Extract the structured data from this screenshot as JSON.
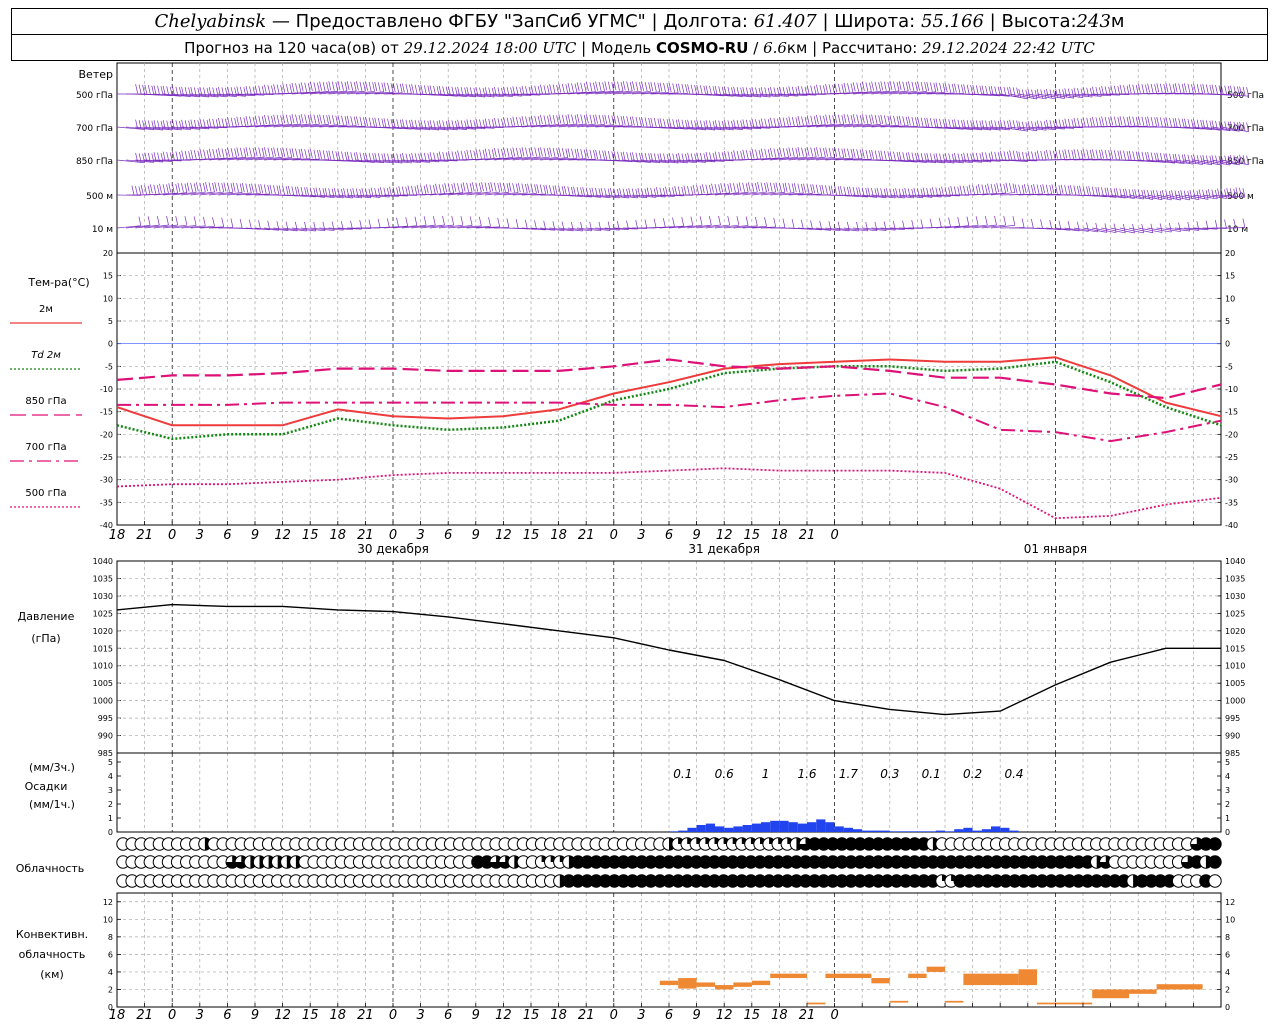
{
  "header": {
    "city": "Chelyabinsk",
    "dash": "—",
    "provider": "Предоставлено ФГБУ \"ЗапСиб УГМС\"",
    "lon_label": "Долгота:",
    "lon": "61.407",
    "lat_label": "Широта:",
    "lat": "55.166",
    "alt_label": "Высота:",
    "alt": "243",
    "alt_unit": "м",
    "sep": "|",
    "forecast_label": "Прогноз на 120 часа(ов) от",
    "forecast_start": "29.12.2024 18:00 UTC",
    "model_label": "Модель",
    "model": "COSMO-RU",
    "slash": "/",
    "resolution": "6.6",
    "res_unit": "км",
    "computed_label": "Рассчитано:",
    "computed": "29.12.2024 22:42 UTC"
  },
  "chart_data": [
    {
      "type": "wind-barbs",
      "title": "Ветер",
      "levels": [
        "500 гПа",
        "700 гПа",
        "850 гПа",
        "500 м",
        "10 м"
      ],
      "color": "#7b2fbf"
    },
    {
      "type": "line",
      "ylabel": "Тем-ра(°C)",
      "ylim": [
        -40,
        20
      ],
      "yticks": [
        20,
        15,
        10,
        5,
        0,
        -5,
        -10,
        -15,
        -20,
        -25,
        -30,
        -35,
        -40
      ],
      "x_hours": [
        0,
        6,
        12,
        18,
        24,
        30,
        36,
        42,
        48,
        54,
        60,
        66,
        72,
        78,
        84,
        90,
        96,
        102,
        108,
        114,
        120
      ],
      "series": [
        {
          "name": "2м",
          "color": "#ee3b3b",
          "style": "solid",
          "values": [
            -14,
            -18,
            -18,
            -18,
            -14.5,
            -16,
            -16.5,
            -16,
            -14.5,
            -11,
            -8.5,
            -5.5,
            -4.5,
            -4,
            -3.5,
            -4,
            -4,
            -3,
            -7,
            -13,
            -16
          ]
        },
        {
          "name": "Td 2м",
          "color": "#118811",
          "style": "dotted",
          "values": [
            -18,
            -21,
            -20,
            -20,
            -16.5,
            -18,
            -19,
            -18.5,
            -17,
            -12.5,
            -10,
            -6.5,
            -5.5,
            -5,
            -5,
            -6,
            -5.5,
            -4,
            -8.5,
            -14,
            -18
          ]
        },
        {
          "name": "850 гПа",
          "color": "#dd1177",
          "style": "dash",
          "values": [
            -8,
            -7,
            -7,
            -6.5,
            -5.5,
            -5.5,
            -6,
            -6,
            -6,
            -5,
            -3.5,
            -5,
            -5.5,
            -5,
            -6,
            -7.5,
            -7.5,
            -9,
            -11,
            -12,
            -9
          ]
        },
        {
          "name": "700 гПа",
          "color": "#dd1177",
          "style": "dashdot",
          "values": [
            -13.5,
            -13.5,
            -13.5,
            -13,
            -13,
            -13,
            -13,
            -13,
            -13,
            -13.5,
            -13.5,
            -14,
            -12.5,
            -11.5,
            -11,
            -14,
            -19,
            -19.5,
            -21.5,
            -19.5,
            -17
          ]
        },
        {
          "name": "500 гПа",
          "color": "#dd1177",
          "style": "finedot",
          "values": [
            -31.5,
            -31,
            -31,
            -30.5,
            -30,
            -29,
            -28.5,
            -28.5,
            -28.5,
            -28.5,
            -28,
            -27.5,
            -28,
            -28,
            -28,
            -28.5,
            -32,
            -38.5,
            -38,
            -35.5,
            -34
          ]
        }
      ],
      "day_labels": [
        "30 декабря",
        "31 декабря",
        "01 января"
      ],
      "hour_labels": [
        "18",
        "21",
        "0",
        "3",
        "6",
        "9",
        "12",
        "15",
        "18",
        "21",
        "0",
        "3",
        "6",
        "9",
        "12",
        "15",
        "18",
        "21",
        "0",
        "3",
        "6",
        "9",
        "12",
        "15",
        "18",
        "21",
        "0"
      ]
    },
    {
      "type": "line",
      "ylabel": "Давление",
      "ylabel2": "(гПа)",
      "ylim": [
        985,
        1040
      ],
      "yticks": [
        1040,
        1035,
        1030,
        1025,
        1020,
        1015,
        1010,
        1005,
        1000,
        995,
        990,
        985
      ],
      "x_hours": [
        0,
        6,
        12,
        18,
        24,
        30,
        36,
        42,
        48,
        54,
        60,
        66,
        72,
        78,
        84,
        90,
        96,
        102,
        108,
        114,
        120
      ],
      "series": [
        {
          "color": "#000000",
          "values": [
            1026,
            1027.5,
            1027,
            1027,
            1026,
            1025.5,
            1024,
            1022,
            1020,
            1018,
            1014.5,
            1011.5,
            1006,
            1000,
            997.5,
            996,
            997,
            1004.5,
            1011,
            1015,
            1015
          ]
        }
      ]
    },
    {
      "type": "bar",
      "ylabel_top": "(мм/3ч.)",
      "ylabel": "Осадки",
      "ylabel_bottom": "(мм/1ч.)",
      "ylim": [
        0,
        5
      ],
      "yticks": [
        5,
        4,
        3,
        2,
        1,
        0
      ],
      "color": "#2244ee",
      "labels": [
        {
          "hour": 61.5,
          "text": "0.1"
        },
        {
          "hour": 66,
          "text": "0.6"
        },
        {
          "hour": 70.5,
          "text": "1"
        },
        {
          "hour": 75,
          "text": "1.6"
        },
        {
          "hour": 79.5,
          "text": "1.7"
        },
        {
          "hour": 84,
          "text": "0.3"
        },
        {
          "hour": 88.5,
          "text": "0.1"
        },
        {
          "hour": 93,
          "text": "0.2"
        },
        {
          "hour": 97.5,
          "text": "0.4"
        }
      ],
      "hours": [
        60.5,
        61.5,
        62.5,
        63.5,
        64.5,
        65.5,
        66.5,
        67.5,
        68.5,
        69.5,
        70.5,
        71.5,
        72.5,
        73.5,
        74.5,
        75.5,
        76.5,
        77.5,
        78.5,
        79.5,
        80.5,
        81.5,
        82.5,
        83.5,
        84.5,
        85.5,
        86.5,
        87.5,
        88.5,
        89.5,
        90.5,
        91.5,
        92.5,
        93.5,
        94.5,
        95.5,
        96.5,
        97.5
      ],
      "values": [
        0.05,
        0.1,
        0.3,
        0.5,
        0.6,
        0.4,
        0.3,
        0.4,
        0.5,
        0.6,
        0.7,
        0.8,
        0.8,
        0.7,
        0.6,
        0.7,
        0.9,
        0.7,
        0.4,
        0.3,
        0.2,
        0.1,
        0.1,
        0.1,
        0.05,
        0.05,
        0.05,
        0.05,
        0.05,
        0.1,
        0.05,
        0.2,
        0.3,
        0.1,
        0.2,
        0.4,
        0.3,
        0.1
      ]
    },
    {
      "type": "symbols",
      "ylabel": "Облачность",
      "rows": [
        {
          "filled": [
            [
              9,
              9,
              0.5
            ],
            [
              60,
              61,
              0.5
            ],
            [
              61,
              74,
              0.25
            ],
            [
              74,
              74,
              0.5
            ],
            [
              75,
              75,
              0.75
            ],
            [
              76,
              88,
              1
            ],
            [
              89,
              89,
              0.5
            ],
            [
              118,
              118,
              0.75
            ],
            [
              119,
              120,
              1
            ]
          ]
        },
        {
          "filled": [
            [
              12,
              13,
              0.75
            ],
            [
              14,
              19,
              0.5
            ],
            [
              39,
              40,
              1
            ],
            [
              41,
              42,
              0.75
            ],
            [
              43,
              43,
              0.5
            ],
            [
              46,
              48,
              0.25
            ],
            [
              49,
              49,
              0.5
            ],
            [
              50,
              106,
              1
            ],
            [
              107,
              107,
              0.5
            ],
            [
              108,
              108,
              0.75
            ],
            [
              117,
              117,
              0.75
            ],
            [
              118,
              118,
              1
            ],
            [
              119,
              119,
              0.5
            ],
            [
              120,
              120,
              1
            ]
          ]
        },
        {
          "filled": [
            [
              48,
              48,
              0.5
            ],
            [
              49,
              89,
              1
            ],
            [
              90,
              91,
              0.25
            ],
            [
              92,
              110,
              1
            ],
            [
              111,
              111,
              0.5
            ],
            [
              112,
              115,
              1
            ],
            [
              119,
              119,
              1
            ]
          ]
        }
      ]
    },
    {
      "type": "bar",
      "ylabel": "Конвективн.",
      "ylabel2": "облачность",
      "ylabel3": "(км)",
      "ylim": [
        0,
        13
      ],
      "yticks": [
        12,
        10,
        8,
        6,
        4,
        2,
        0
      ],
      "color": "#ee8833",
      "segments": [
        [
          59,
          61,
          2.5,
          3.0
        ],
        [
          61,
          63,
          2.1,
          3.3
        ],
        [
          63,
          65,
          2.3,
          2.8
        ],
        [
          65,
          67,
          2.0,
          2.5
        ],
        [
          67,
          69,
          2.3,
          2.8
        ],
        [
          69,
          71,
          2.5,
          3.0
        ],
        [
          71,
          75,
          3.3,
          3.8
        ],
        [
          75,
          77,
          0.3,
          0.5
        ],
        [
          77,
          82,
          3.3,
          3.8
        ],
        [
          82,
          84,
          2.7,
          3.3
        ],
        [
          84,
          86,
          0.5,
          0.7
        ],
        [
          86,
          88,
          3.3,
          3.8
        ],
        [
          88,
          90,
          4.0,
          4.6
        ],
        [
          90,
          92,
          0.5,
          0.7
        ],
        [
          92,
          98,
          2.5,
          3.8
        ],
        [
          98,
          100,
          2.5,
          4.3
        ],
        [
          100,
          106,
          0.3,
          0.5
        ],
        [
          106,
          110,
          1.0,
          2.0
        ],
        [
          110,
          113,
          1.5,
          2.0
        ],
        [
          113,
          118,
          2.0,
          2.6
        ]
      ]
    }
  ]
}
